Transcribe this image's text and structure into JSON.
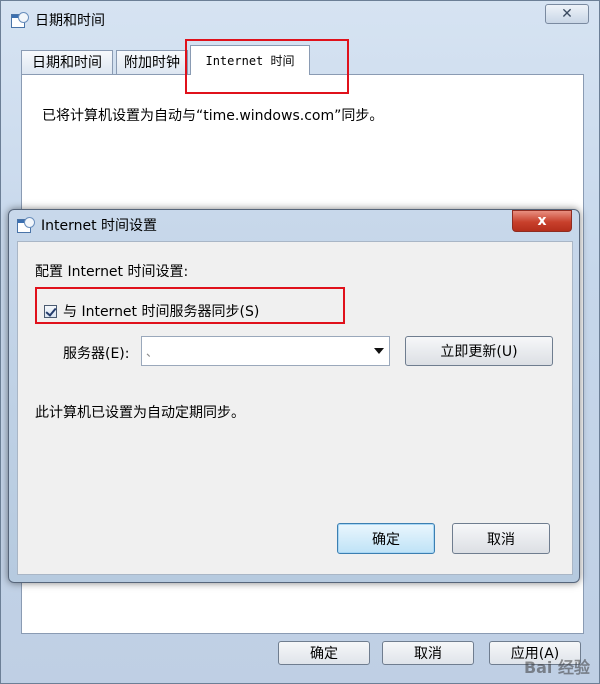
{
  "outer_window": {
    "title": "日期和时间",
    "close_label": "✕",
    "tabs": [
      {
        "label": "日期和时间"
      },
      {
        "label": "附加时钟"
      },
      {
        "label": "Internet 时间"
      }
    ],
    "sync_message": "已将计算机设置为自动与“time.windows.com”同步。",
    "buttons": {
      "ok": "确定",
      "cancel": "取消",
      "apply": "应用(A)"
    }
  },
  "dialog": {
    "title": "Internet 时间设置",
    "close_label": "x",
    "configure_label": "配置 Internet 时间设置:",
    "sync_checkbox_label": "与 Internet 时间服务器同步(S)",
    "sync_checked": true,
    "server_label": "服务器(E):",
    "server_value": "、",
    "update_now_label": "立即更新(U)",
    "auto_sync_note": "此计算机已设置为自动定期同步。",
    "ok_label": "确定",
    "cancel_label": "取消"
  },
  "watermark": "Bai 经验",
  "colors": {
    "highlight": "#e0111b",
    "dialog_close": "#c8402c"
  }
}
